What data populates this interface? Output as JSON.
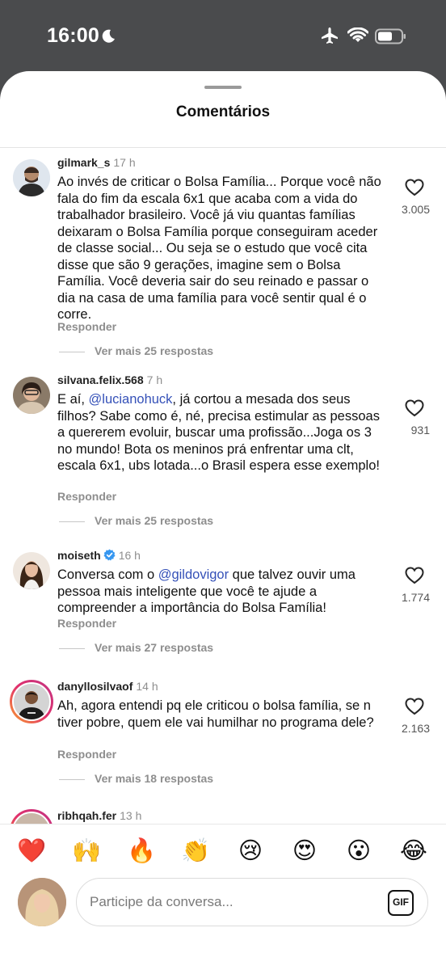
{
  "status_bar": {
    "time": "16:00"
  },
  "sheet": {
    "title": "Comentários"
  },
  "comments": [
    {
      "username": "gilmark_s",
      "time": "17 h",
      "verified": false,
      "text": "Ao invés de criticar o Bolsa Família... Porque você não fala do fim da escala 6x1 que acaba com a vida do trabalhador brasileiro. Você já viu quantas famílias deixaram o Bolsa Família porque conseguiram aceder de classe social... Ou seja se o estudo que você cita disse que são 9 gerações, imagine sem o Bolsa Família. Você deveria sair do seu reinado e passar o dia na casa de uma família para você sentir qual é o corre.",
      "likes": "3.005",
      "reply_label": "Responder",
      "more_replies": "Ver mais 25 respostas"
    },
    {
      "username": "silvana.felix.568",
      "time": "7 h",
      "verified": false,
      "text_before": "E aí, ",
      "mention": "@lucianohuck",
      "text_after": ", já cortou a mesada dos seus filhos? Sabe como é, né, precisa estimular as pessoas a quererem evoluir, buscar uma profissão...Joga os 3 no mundo! Bota os meninos prá enfrentar uma clt, escala 6x1, ubs lotada...o Brasil espera esse exemplo!",
      "likes": "931",
      "reply_label": "Responder",
      "more_replies": "Ver mais 25 respostas"
    },
    {
      "username": "moiseth",
      "time": "16 h",
      "verified": true,
      "text_before": "Conversa com o ",
      "mention": "@gildovigor",
      "text_after": " que talvez ouvir uma pessoa mais inteligente que você te ajude a compreender a importância do Bolsa Família!",
      "likes": "1.774",
      "reply_label": "Responder",
      "more_replies": "Ver mais 27 respostas"
    },
    {
      "username": "danyllosilvaof",
      "time": "14 h",
      "verified": false,
      "text": "Ah, agora entendi pq ele criticou o bolsa família, se n tiver pobre, quem ele vai humilhar no programa dele?",
      "likes": "2.163",
      "reply_label": "Responder",
      "more_replies": "Ver mais 18 respostas"
    },
    {
      "username": "ribhqah.fer",
      "time": "13 h",
      "verified": false
    }
  ],
  "emoji_reactions": [
    "❤️",
    "🙌",
    "🔥",
    "👏",
    "😢",
    "😍",
    "😮",
    "😂"
  ],
  "composer": {
    "placeholder": "Participe da conversa...",
    "gif_label": "GIF"
  },
  "colors": {
    "mention": "#3551b8",
    "status_bar_bg": "#4a4b4d",
    "muted_text": "#8e8e8e",
    "story_ring": "#e1306c"
  }
}
